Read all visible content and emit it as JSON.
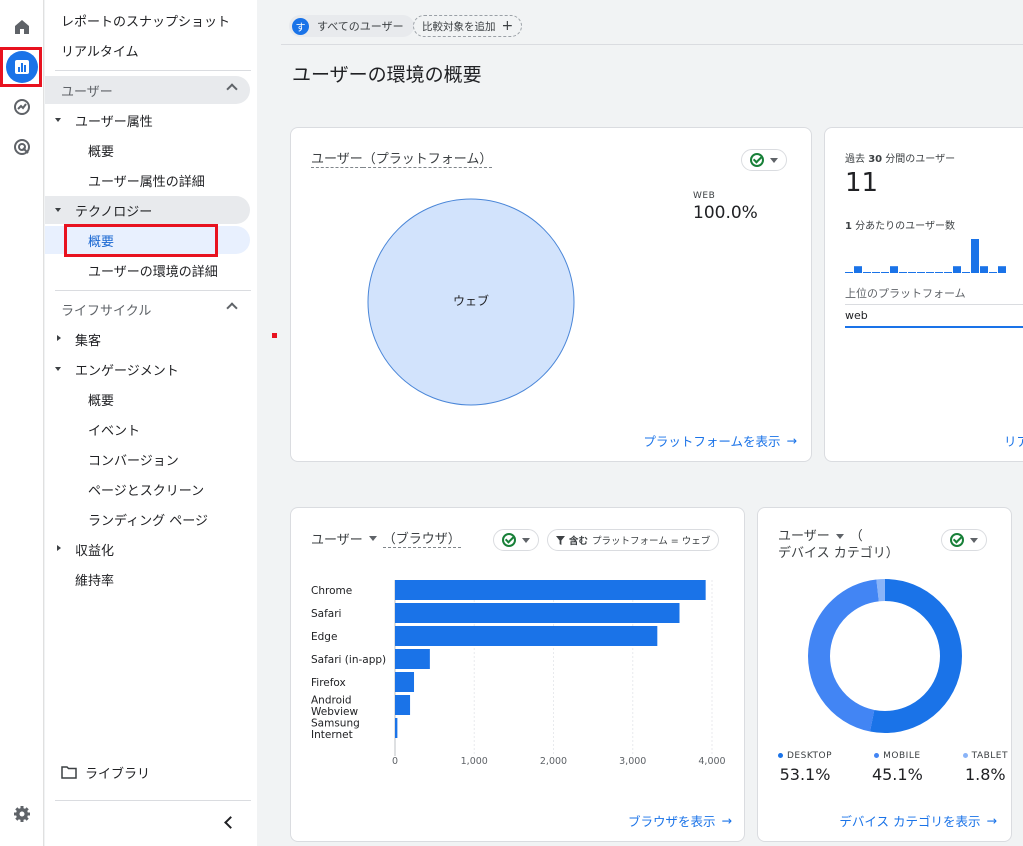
{
  "nav": {
    "snapshot": "レポートのスナップショット",
    "realtime": "リアルタイム",
    "user_section": "ユーザー",
    "user_attributes": "ユーザー属性",
    "ua_overview": "概要",
    "ua_detail": "ユーザー属性の詳細",
    "technology": "テクノロジー",
    "tech_overview": "概要",
    "tech_detail": "ユーザーの環境の詳細",
    "lifecycle_section": "ライフサイクル",
    "acquisition": "集客",
    "engagement": "エンゲージメント",
    "eng_overview": "概要",
    "events": "イベント",
    "conversions": "コンバージョン",
    "pages": "ページとスクリーン",
    "landing": "ランディング ページ",
    "monetization": "収益化",
    "retention": "維持率",
    "library": "ライブラリ"
  },
  "header": {
    "segment_avatar": "す",
    "segment_label": "すべてのユーザー",
    "add_comparison": "比較対象を追加",
    "page_title": "ユーザーの環境の概要"
  },
  "platform_card": {
    "title_metric": "ユーザー",
    "title_dim": "（プラットフォーム）",
    "legend_label": "WEB",
    "legend_value": "100.0%",
    "pie_label": "ウェブ",
    "link": "プラットフォームを表示"
  },
  "realtime_card": {
    "prefix": "過去",
    "minutes": "30",
    "suffix": "分間のユーザー",
    "count": "11",
    "per_min_num": "1",
    "per_min": "分あたりのユーザー数",
    "top_platform": "上位のプラットフォーム",
    "platform": "web",
    "link": "リア"
  },
  "browser_card": {
    "title_metric": "ユーザー",
    "title_dim": "（ブラウザ）",
    "filter_bold": "含む",
    "filter_text": "プラットフォーム = ウェブ",
    "link": "ブラウザを表示"
  },
  "device_card": {
    "title_l1": "ユーザー",
    "title_l1b": "（",
    "title_l2": "デバイス カテゴリ）",
    "link": "デバイス カテゴリを表示"
  },
  "colors": {
    "accent": "#1a73e8",
    "bar": "#1a73e8",
    "pie": "#d2e3fc",
    "mobile": "#4285f4",
    "tablet": "#8ab4f8",
    "alert": "#e8121f"
  },
  "chart_data": [
    {
      "type": "pie",
      "categories": [
        "ウェブ"
      ],
      "values": [
        100.0
      ]
    },
    {
      "type": "bar",
      "orientation": "horizontal",
      "categories": [
        "Chrome",
        "Safari",
        "Edge",
        "Safari (in-app)",
        "Firefox",
        "Android Webview",
        "Samsung Internet"
      ],
      "values": [
        3920,
        3590,
        3310,
        440,
        240,
        190,
        30
      ],
      "xlim": [
        0,
        4000
      ],
      "ticks": [
        0,
        1000,
        2000,
        3000,
        4000
      ],
      "tick_labels": [
        "0",
        "1,000",
        "2,000",
        "3,000",
        "4,000"
      ]
    },
    {
      "type": "pie",
      "donut": true,
      "categories": [
        "DESKTOP",
        "MOBILE",
        "TABLET"
      ],
      "values": [
        53.1,
        45.1,
        1.8
      ],
      "value_labels": [
        "53.1%",
        "45.1%",
        "1.8%"
      ]
    },
    {
      "type": "bar",
      "values": [
        0,
        1,
        0,
        0,
        0,
        1,
        0,
        0,
        0,
        0,
        0,
        0,
        1,
        0,
        5,
        1,
        0,
        1
      ]
    }
  ]
}
